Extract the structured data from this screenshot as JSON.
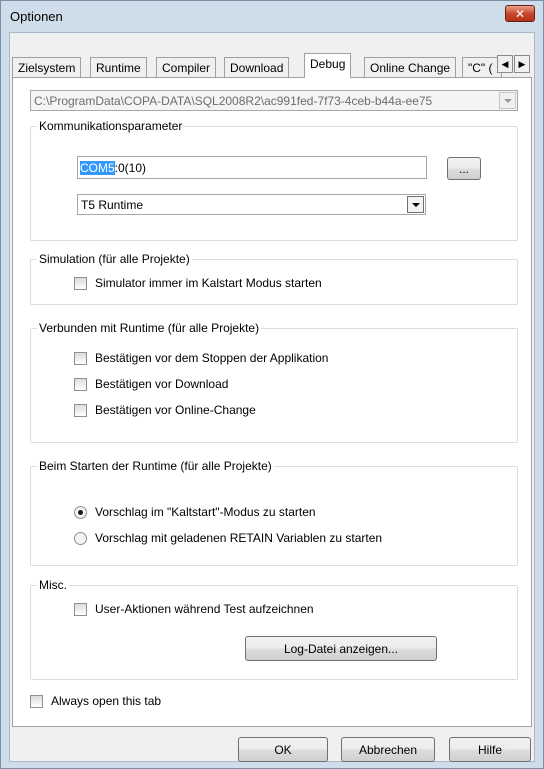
{
  "window": {
    "title": "Optionen",
    "close_glyph": "✕"
  },
  "tabs": [
    {
      "label": "Zielsystem"
    },
    {
      "label": "Runtime"
    },
    {
      "label": "Compiler"
    },
    {
      "label": "Download"
    },
    {
      "label": "Debug",
      "active": true
    },
    {
      "label": "Online Change"
    },
    {
      "label": "\"C\" ("
    }
  ],
  "tab_scroll": {
    "left_glyph": "◀",
    "right_glyph": "▶"
  },
  "path_combo": {
    "value": "C:\\ProgramData\\COPA-DATA\\SQL2008R2\\ac991fed-7f73-4ceb-b44a-ee75"
  },
  "kommunikation": {
    "legend": "Kommunikationsparameter",
    "connection_selected": "COM5",
    "connection_rest": ":0(10)",
    "browse_label": "...",
    "runtime_value": "T5 Runtime"
  },
  "simulation": {
    "legend": "Simulation (für alle Projekte)",
    "cold_start_label": "Simulator immer im Kalstart Modus starten"
  },
  "verbunden": {
    "legend": "Verbunden mit Runtime (für alle Projekte)",
    "items": [
      "Bestätigen vor dem Stoppen der Applikation",
      "Bestätigen vor Download",
      "Bestätigen vor Online-Change"
    ]
  },
  "beim_starten": {
    "legend": "Beim Starten der Runtime (für alle Projekte)",
    "options": [
      "Vorschlag im \"Kaltstart\"-Modus zu starten",
      "Vorschlag mit geladenen RETAIN Variablen zu starten"
    ]
  },
  "misc": {
    "legend": "Misc.",
    "record_label": "User-Aktionen während Test aufzeichnen",
    "log_button": "Log-Datei anzeigen..."
  },
  "always_open_label": "Always open this tab",
  "buttons": {
    "ok": "OK",
    "cancel": "Abbrechen",
    "help": "Hilfe"
  }
}
